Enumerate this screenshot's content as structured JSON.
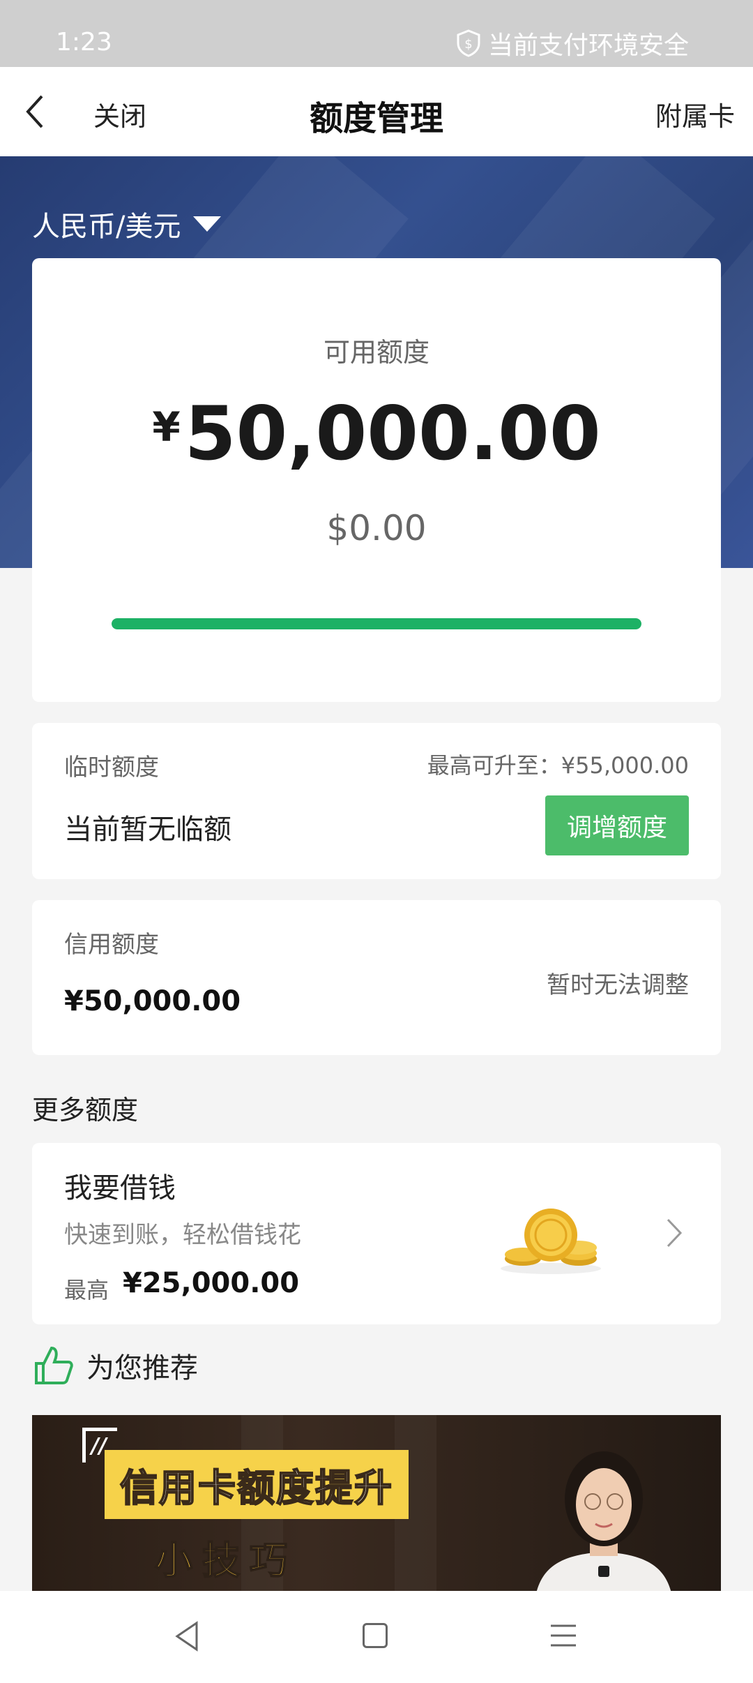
{
  "status_bar": {
    "time": "1:23",
    "security_text": "当前支付环境安全"
  },
  "nav": {
    "close_label": "关闭",
    "title": "额度管理",
    "sub_card_label": "附属卡"
  },
  "currency_switch": {
    "label": "人民币/美元"
  },
  "available": {
    "label": "可用额度",
    "currency_symbol": "¥",
    "amount": "50,000.00",
    "usd_amount": "$0.00",
    "usage_fraction": 1.0
  },
  "temporary": {
    "label": "临时额度",
    "max_text": "最高可升至：¥55,000.00",
    "status": "当前暂无临额",
    "button_label": "调增额度"
  },
  "credit": {
    "label": "信用额度",
    "amount": "¥50,000.00",
    "note": "暂时无法调整"
  },
  "more": {
    "title": "更多额度"
  },
  "loan": {
    "title": "我要借钱",
    "subtitle": "快速到账，轻松借钱花",
    "max_label": "最高",
    "max_value": "¥25,000.00"
  },
  "recommend": {
    "title": "为您推荐"
  },
  "banner": {
    "headline": "信用卡额度提升",
    "sub": "小技巧"
  },
  "colors": {
    "hero_blue": "#2e4680",
    "accent_green": "#4cbc6a",
    "progress_green": "#1db165"
  },
  "icons": [
    "shield-icon",
    "back-icon",
    "caret-icon",
    "coins-icon",
    "chevron-right-icon",
    "thumb-icon",
    "sys-back-icon",
    "sys-home-icon",
    "sys-menu-icon"
  ]
}
